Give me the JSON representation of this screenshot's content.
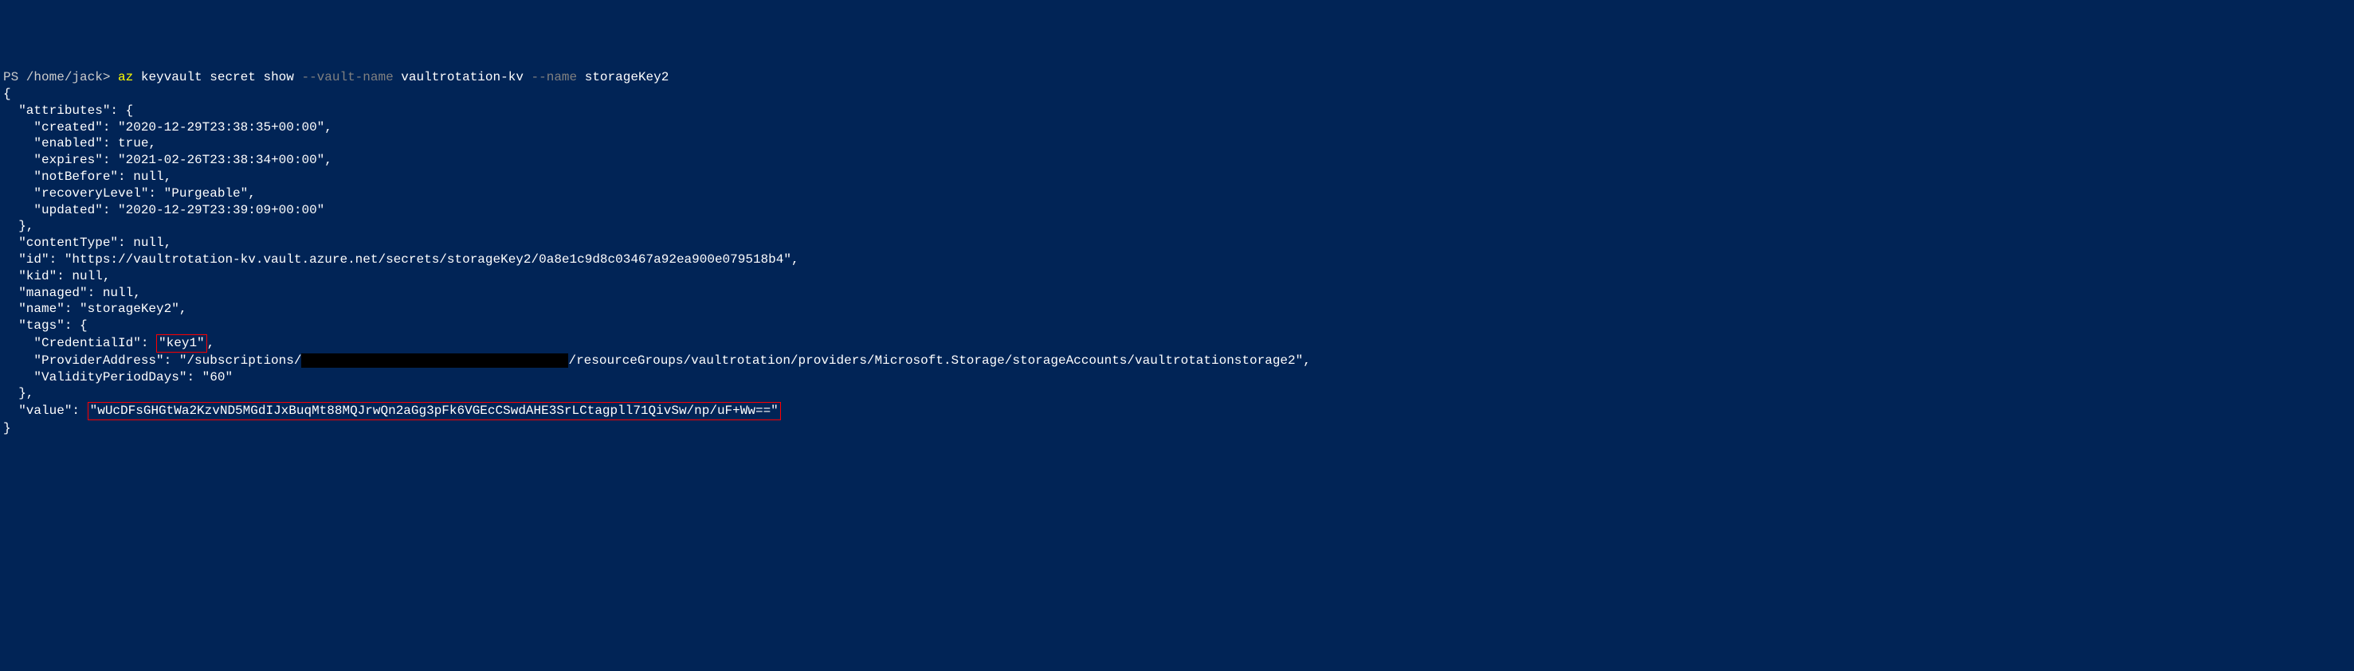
{
  "prompt": {
    "prefix": "PS /home/jack> ",
    "cmd_part1": "az",
    "cmd_part2": " keyvault secret show ",
    "flag1": "--vault-name",
    "arg1": " vaultrotation-kv ",
    "flag2": "--name",
    "arg2": " storageKey2"
  },
  "json_output": {
    "open_brace": "{",
    "attributes_key": "  \"attributes\": {",
    "created": "    \"created\": \"2020-12-29T23:38:35+00:00\",",
    "enabled": "    \"enabled\": true,",
    "expires": "    \"expires\": \"2021-02-26T23:38:34+00:00\",",
    "notBefore": "    \"notBefore\": null,",
    "recoveryLevel": "    \"recoveryLevel\": \"Purgeable\",",
    "updated": "    \"updated\": \"2020-12-29T23:39:09+00:00\"",
    "attributes_close": "  },",
    "contentType": "  \"contentType\": null,",
    "id": "  \"id\": \"https://vaultrotation-kv.vault.azure.net/secrets/storageKey2/0a8e1c9d8c03467a92ea900e079518b4\",",
    "kid": "  \"kid\": null,",
    "managed": "  \"managed\": null,",
    "name": "  \"name\": \"storageKey2\",",
    "tags_key": "  \"tags\": {",
    "credentialId_pre": "    \"CredentialId\": ",
    "credentialId_val": "\"key1\"",
    "credentialId_post": ",",
    "providerAddress_pre": "    \"ProviderAddress\": \"/subscriptions/",
    "providerAddress_post": "/resourceGroups/vaultrotation/providers/Microsoft.Storage/storageAccounts/vaultrotationstorage2\",",
    "validityPeriodDays": "    \"ValidityPeriodDays\": \"60\"",
    "tags_close": "  },",
    "value_pre": "  \"value\": ",
    "value_val": "\"wUcDFsGHGtWa2KzvND5MGdIJxBuqMt88MQJrwQn2aGg3pFk6VGEcCSwdAHE3SrLCtagpll71QivSw/np/uF+Ww==\"",
    "close_brace": "}"
  }
}
